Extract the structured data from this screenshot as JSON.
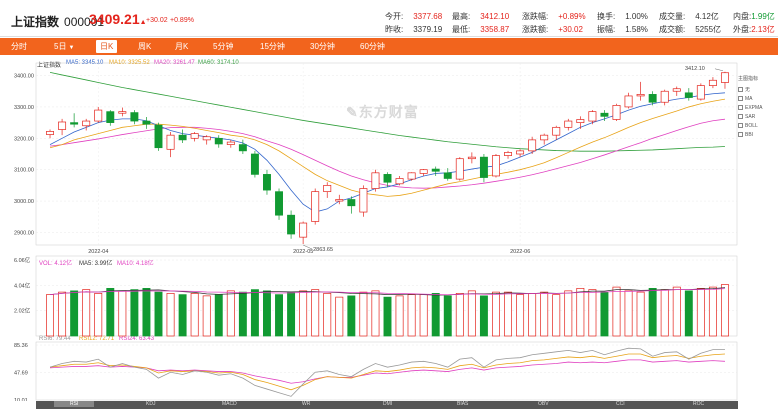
{
  "header": {
    "name": "上证指数",
    "code": "000001",
    "price": "3409.21",
    "arrow": "▲",
    "change": "+30.02",
    "pct": "+0.89%"
  },
  "stats": {
    "open_l": "今开:",
    "open_v": "3377.68",
    "high_l": "最高:",
    "high_v": "3412.10",
    "chgpct_l": "涨跌幅:",
    "chgpct_v": "+0.89%",
    "turn_l": "换手:",
    "turn_v": "1.00%",
    "vol_l": "成交量:",
    "vol_v": "4.12亿",
    "inner_l": "内盘:",
    "inner_v": "1.99亿",
    "prev_l": "昨收:",
    "prev_v": "3379.19",
    "low_l": "最低:",
    "low_v": "3358.87",
    "chgamt_l": "涨跌额:",
    "chgamt_v": "+30.02",
    "amp_l": "振幅:",
    "amp_v": "1.58%",
    "amt_l": "成交额:",
    "amt_v": "5255亿",
    "outer_l": "外盘:",
    "outer_v": "2.13亿"
  },
  "tabs": [
    "分时",
    "5日",
    "日K",
    "周K",
    "月K",
    "5分钟",
    "15分钟",
    "30分钟",
    "60分钟"
  ],
  "active_tab": "日K",
  "chart_title": "上证指数",
  "ma_legend": [
    {
      "l": "MA5: 3345.10",
      "c": "#3366cc"
    },
    {
      "l": "MA10: 3325.52",
      "c": "#e8a317"
    },
    {
      "l": "MA20: 3261.47",
      "c": "#e040c0"
    },
    {
      "l": "MA60: 3174.10",
      "c": "#2f9e3a"
    }
  ],
  "vol_legend": [
    {
      "l": "VOL: 4.12亿",
      "c": "#e040c0"
    },
    {
      "l": "MA5: 3.99亿",
      "c": "#333333"
    },
    {
      "l": "MA10: 4.18亿",
      "c": "#e040c0"
    }
  ],
  "rsi_legend": [
    {
      "l": "RSI6: 79.44",
      "c": "#999999"
    },
    {
      "l": "RSI12: 72.71",
      "c": "#e8a317"
    },
    {
      "l": "RSI24: 63.43",
      "c": "#e040c0"
    }
  ],
  "indicators": {
    "title": "主图指标",
    "items": [
      "无",
      "MA",
      "EXPMA",
      "SAR",
      "BOLL",
      "BBI"
    ]
  },
  "watermark": "东方财富",
  "bottom_tabs": [
    "RSI",
    "KDJ",
    "MACD",
    "WR",
    "DMI",
    "BIAS",
    "OBV",
    "CCI",
    "ROC"
  ],
  "active_bottom": "RSI",
  "chart_data": [
    {
      "type": "candlestick",
      "price_ticks": [
        3400,
        3300,
        3200,
        3100,
        3000,
        2900
      ],
      "price_labels": [
        "3400.00",
        "3300.00",
        "3200.00",
        "3100.00",
        "3000.00",
        "2900.00"
      ],
      "x_labels": [
        "2022-04",
        "2022-05",
        "2022-06"
      ],
      "high_label": "3412.10",
      "low_label": "2863.65",
      "ohlc": [
        [
          3212,
          3228,
          3200,
          3222
        ],
        [
          3228,
          3262,
          3210,
          3252
        ],
        [
          3250,
          3280,
          3235,
          3245
        ],
        [
          3240,
          3262,
          3225,
          3255
        ],
        [
          3255,
          3300,
          3250,
          3290
        ],
        [
          3285,
          3290,
          3240,
          3250
        ],
        [
          3280,
          3298,
          3270,
          3285
        ],
        [
          3282,
          3290,
          3245,
          3255
        ],
        [
          3255,
          3268,
          3230,
          3245
        ],
        [
          3242,
          3250,
          3160,
          3170
        ],
        [
          3165,
          3220,
          3140,
          3210
        ],
        [
          3210,
          3228,
          3185,
          3195
        ],
        [
          3200,
          3220,
          3190,
          3215
        ],
        [
          3195,
          3210,
          3180,
          3205
        ],
        [
          3200,
          3210,
          3170,
          3182
        ],
        [
          3180,
          3195,
          3170,
          3188
        ],
        [
          3180,
          3196,
          3150,
          3160
        ],
        [
          3150,
          3160,
          3075,
          3085
        ],
        [
          3085,
          3100,
          3020,
          3035
        ],
        [
          3030,
          3040,
          2940,
          2955
        ],
        [
          2955,
          2970,
          2880,
          2895
        ],
        [
          2885,
          2935,
          2863,
          2930
        ],
        [
          2935,
          3040,
          2925,
          3030
        ],
        [
          3030,
          3060,
          3010,
          3050
        ],
        [
          3000,
          3020,
          2990,
          3005
        ],
        [
          3005,
          3015,
          2960,
          2985
        ],
        [
          2965,
          3050,
          2950,
          3040
        ],
        [
          3040,
          3100,
          3030,
          3090
        ],
        [
          3085,
          3092,
          3045,
          3060
        ],
        [
          3055,
          3080,
          3050,
          3072
        ],
        [
          3070,
          3092,
          3065,
          3090
        ],
        [
          3088,
          3102,
          3080,
          3100
        ],
        [
          3102,
          3110,
          3080,
          3095
        ],
        [
          3090,
          3105,
          3065,
          3072
        ],
        [
          3070,
          3140,
          3065,
          3135
        ],
        [
          3135,
          3155,
          3120,
          3140
        ],
        [
          3140,
          3150,
          3060,
          3075
        ],
        [
          3080,
          3150,
          3075,
          3145
        ],
        [
          3145,
          3160,
          3135,
          3155
        ],
        [
          3150,
          3165,
          3140,
          3160
        ],
        [
          3160,
          3205,
          3150,
          3195
        ],
        [
          3195,
          3215,
          3180,
          3210
        ],
        [
          3210,
          3240,
          3195,
          3235
        ],
        [
          3235,
          3262,
          3225,
          3255
        ],
        [
          3250,
          3270,
          3230,
          3260
        ],
        [
          3255,
          3290,
          3245,
          3285
        ],
        [
          3280,
          3290,
          3255,
          3270
        ],
        [
          3260,
          3310,
          3255,
          3305
        ],
        [
          3300,
          3345,
          3295,
          3335
        ],
        [
          3335,
          3380,
          3320,
          3340
        ],
        [
          3340,
          3350,
          3305,
          3315
        ],
        [
          3315,
          3355,
          3305,
          3350
        ],
        [
          3350,
          3365,
          3335,
          3358
        ],
        [
          3345,
          3360,
          3320,
          3330
        ],
        [
          3325,
          3375,
          3320,
          3368
        ],
        [
          3368,
          3395,
          3360,
          3385
        ],
        [
          3378,
          3412,
          3358,
          3409
        ]
      ],
      "ma5": [
        3180,
        3200,
        3220,
        3235,
        3250,
        3258,
        3262,
        3262,
        3256,
        3240,
        3225,
        3215,
        3210,
        3205,
        3200,
        3195,
        3185,
        3165,
        3130,
        3085,
        3035,
        2990,
        2965,
        2975,
        3000,
        3010,
        3025,
        3040,
        3045,
        3055,
        3068,
        3080,
        3088,
        3090,
        3095,
        3102,
        3108,
        3112,
        3125,
        3140,
        3155,
        3175,
        3195,
        3215,
        3235,
        3250,
        3262,
        3275,
        3290,
        3302,
        3310,
        3318,
        3325,
        3330,
        3337,
        3342,
        3345
      ],
      "ma10": [
        3170,
        3180,
        3195,
        3205,
        3215,
        3225,
        3235,
        3240,
        3245,
        3245,
        3242,
        3238,
        3232,
        3225,
        3218,
        3210,
        3205,
        3195,
        3180,
        3160,
        3135,
        3110,
        3085,
        3065,
        3050,
        3035,
        3025,
        3020,
        3015,
        3018,
        3025,
        3035,
        3045,
        3055,
        3062,
        3070,
        3078,
        3085,
        3092,
        3100,
        3110,
        3122,
        3138,
        3155,
        3172,
        3188,
        3202,
        3218,
        3235,
        3250,
        3263,
        3275,
        3287,
        3300,
        3310,
        3318,
        3325
      ],
      "ma20": [
        3175,
        3180,
        3186,
        3192,
        3198,
        3205,
        3212,
        3218,
        3224,
        3230,
        3234,
        3235,
        3235,
        3232,
        3228,
        3222,
        3215,
        3205,
        3192,
        3180,
        3165,
        3148,
        3130,
        3112,
        3095,
        3080,
        3068,
        3058,
        3050,
        3045,
        3042,
        3041,
        3042,
        3045,
        3048,
        3052,
        3057,
        3063,
        3069,
        3076,
        3084,
        3093,
        3103,
        3113,
        3123,
        3135,
        3147,
        3160,
        3173,
        3186,
        3200,
        3212,
        3225,
        3237,
        3248,
        3256,
        3261
      ],
      "ma60": [
        3410,
        3402,
        3394,
        3386,
        3378,
        3370,
        3362,
        3355,
        3348,
        3341,
        3334,
        3327,
        3320,
        3313,
        3306,
        3299,
        3292,
        3285,
        3278,
        3271,
        3264,
        3257,
        3251,
        3245,
        3239,
        3233,
        3227,
        3221,
        3215,
        3209,
        3204,
        3199,
        3194,
        3189,
        3185,
        3181,
        3177,
        3173,
        3170,
        3167,
        3165,
        3163,
        3161,
        3160,
        3159,
        3159,
        3159,
        3160,
        3161,
        3162,
        3163,
        3165,
        3167,
        3169,
        3171,
        3172,
        3174
      ],
      "volume": [
        3.3,
        3.5,
        3.6,
        3.7,
        3.4,
        3.8,
        3.6,
        3.7,
        3.8,
        3.5,
        3.4,
        3.3,
        3.4,
        3.2,
        3.3,
        3.6,
        3.5,
        3.7,
        3.6,
        3.3,
        3.5,
        3.6,
        3.7,
        3.4,
        3.1,
        3.2,
        3.5,
        3.6,
        3.1,
        3.2,
        3.3,
        3.3,
        3.4,
        3.2,
        3.4,
        3.6,
        3.2,
        3.5,
        3.5,
        3.3,
        3.4,
        3.5,
        3.3,
        3.6,
        3.8,
        3.7,
        3.5,
        3.9,
        3.6,
        3.5,
        3.8,
        3.7,
        3.9,
        3.6,
        3.8,
        3.9,
        4.1
      ],
      "vol_ticks": [
        "6.06亿",
        "4.04亿",
        "2.02亿"
      ],
      "rsi_ticks": [
        "85.36",
        "47.69",
        "10.01"
      ],
      "rsi6": [
        55,
        60,
        63,
        62,
        66,
        55,
        60,
        55,
        52,
        40,
        48,
        45,
        50,
        48,
        44,
        46,
        40,
        30,
        25,
        20,
        15,
        32,
        48,
        50,
        45,
        42,
        52,
        60,
        55,
        58,
        62,
        63,
        60,
        55,
        66,
        68,
        55,
        65,
        67,
        68,
        72,
        74,
        76,
        78,
        75,
        78,
        72,
        77,
        81,
        80,
        70,
        75,
        76,
        66,
        74,
        79,
        79
      ],
      "rsi12": [
        55,
        57,
        59,
        59,
        61,
        57,
        58,
        56,
        54,
        47,
        50,
        49,
        50,
        49,
        47,
        48,
        45,
        38,
        34,
        29,
        24,
        30,
        38,
        42,
        41,
        40,
        45,
        50,
        49,
        51,
        54,
        55,
        54,
        52,
        57,
        59,
        54,
        58,
        60,
        61,
        64,
        65,
        67,
        69,
        68,
        70,
        67,
        70,
        73,
        73,
        68,
        70,
        71,
        67,
        70,
        72,
        73
      ],
      "rsi24": [
        54,
        55,
        56,
        56,
        57,
        55,
        56,
        55,
        54,
        50,
        51,
        50,
        51,
        50,
        49,
        49,
        47,
        43,
        40,
        37,
        33,
        35,
        39,
        42,
        41,
        41,
        44,
        47,
        46,
        48,
        50,
        51,
        50,
        49,
        52,
        54,
        51,
        54,
        55,
        56,
        58,
        59,
        60,
        62,
        61,
        62,
        61,
        63,
        65,
        65,
        62,
        63,
        64,
        62,
        63,
        64,
        63
      ]
    }
  ]
}
